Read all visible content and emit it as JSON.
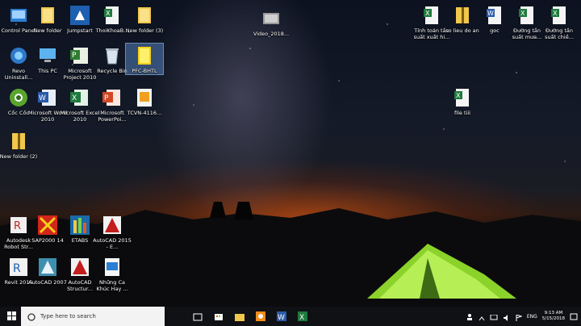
{
  "desktop": {
    "icons": [
      {
        "label": "Control Panel",
        "icon": "control-panel-icon"
      },
      {
        "label": "New folder",
        "icon": "folder-icon"
      },
      {
        "label": "Jumpstart",
        "icon": "jumpstart-icon"
      },
      {
        "label": "ThoiKhoaB...",
        "icon": "excel-file-icon"
      },
      {
        "label": "New folder (3)",
        "icon": "folder-icon"
      },
      {
        "label": "Video_2018...",
        "icon": "video-file-icon"
      },
      {
        "label": "Tính toán tần suất xuất hi...",
        "icon": "excel-file-icon"
      },
      {
        "label": "so lieu do an",
        "icon": "zip-folder-icon"
      },
      {
        "label": "goc",
        "icon": "word-file-icon"
      },
      {
        "label": "Đường tần suất mưa...",
        "icon": "excel-file-icon"
      },
      {
        "label": "Đường tần suất chiề...",
        "icon": "excel-file-icon"
      },
      {
        "label": "Revo Uninstall...",
        "icon": "revo-uninstaller-icon"
      },
      {
        "label": "This PC",
        "icon": "this-pc-icon"
      },
      {
        "label": "Microsoft Project 2010",
        "icon": "ms-project-icon"
      },
      {
        "label": "Recycle Bin",
        "icon": "recycle-bin-icon"
      },
      {
        "label": "PFC-BHTL",
        "icon": "folder-icon"
      },
      {
        "label": "Cốc Cốc",
        "icon": "coccoc-browser-icon"
      },
      {
        "label": "Microsoft Word 2010",
        "icon": "ms-word-icon"
      },
      {
        "label": "Microsoft Excel 2010",
        "icon": "ms-excel-icon"
      },
      {
        "label": "Microsoft PowerPoi...",
        "icon": "ms-powerpoint-icon"
      },
      {
        "label": "TCVN-4116...",
        "icon": "pdf-file-icon"
      },
      {
        "label": "file tiii",
        "icon": "excel-file-icon"
      },
      {
        "label": "New folder (2)",
        "icon": "zip-folder-icon"
      },
      {
        "label": "Autodesk Robot Str...",
        "icon": "robot-structural-icon"
      },
      {
        "label": "SAP2000 14",
        "icon": "sap2000-icon"
      },
      {
        "label": "ETABS",
        "icon": "etabs-icon"
      },
      {
        "label": "AutoCAD 2015 - E...",
        "icon": "autocad-icon"
      },
      {
        "label": "Revit 2015",
        "icon": "revit-icon"
      },
      {
        "label": "AutoCAD 2007",
        "icon": "autocad-icon"
      },
      {
        "label": "AutoCAD Structur...",
        "icon": "autocad-icon"
      },
      {
        "label": "Những Ca Khúc Hay ...",
        "icon": "video-file-icon"
      }
    ]
  },
  "taskbar": {
    "search_placeholder": "Type here to search",
    "language": "ENG",
    "time": "9:13 AM",
    "date": "5/15/2018",
    "pinned": [
      "task-view-icon",
      "store-icon",
      "file-explorer-icon",
      "coccoc-taskbar-icon",
      "word-taskbar-icon",
      "excel-taskbar-icon"
    ]
  }
}
